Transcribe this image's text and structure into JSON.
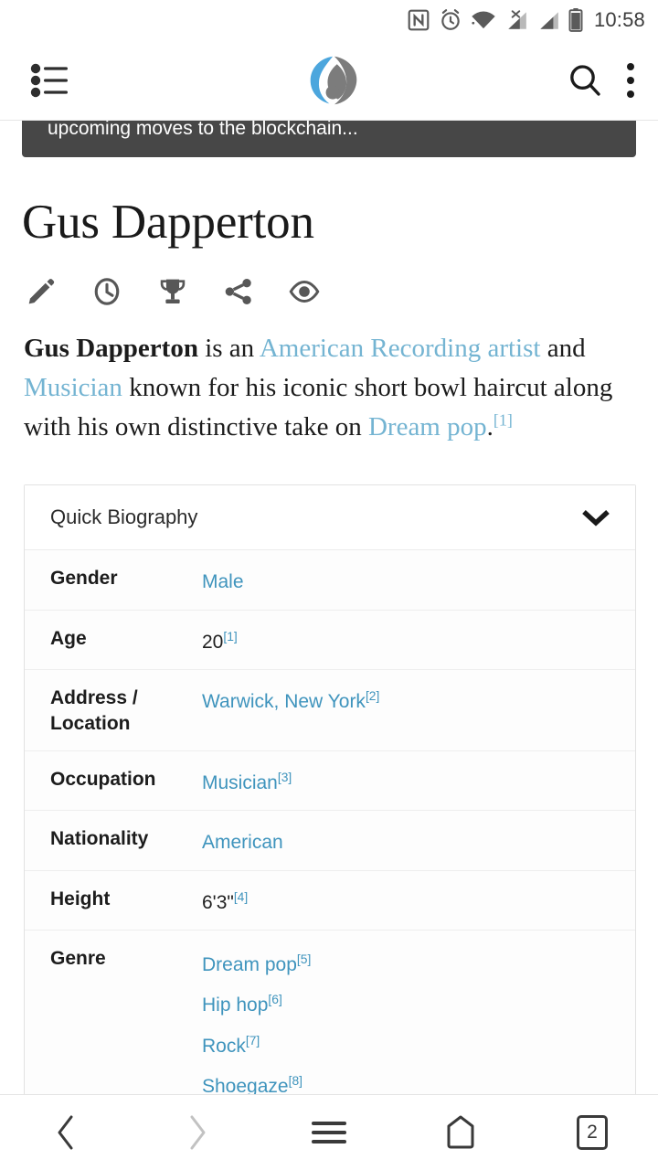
{
  "status_bar": {
    "time": "10:58",
    "icons": [
      "nfc-icon",
      "alarm-icon",
      "wifi-icon",
      "signal-no-sim-icon",
      "signal-icon",
      "battery-icon"
    ]
  },
  "app_bar": {
    "menu_icon": "list-menu-icon",
    "logo_icon": "everipedia-logo-icon",
    "logo_colors": {
      "blue": "#4ca6dd",
      "gray": "#7c7c7c"
    },
    "search_icon": "search-icon",
    "overflow_icon": "more-vertical-icon"
  },
  "banner": {
    "text": "upcoming moves to the blockchain...",
    "background": "#474747"
  },
  "article": {
    "title": "Gus Dapperton",
    "actions": [
      {
        "name": "edit-icon",
        "label": "Edit"
      },
      {
        "name": "history-clock-icon",
        "label": "History"
      },
      {
        "name": "trophy-icon",
        "label": "Awards"
      },
      {
        "name": "share-icon",
        "label": "Share"
      },
      {
        "name": "views-eye-icon",
        "label": "Views"
      }
    ],
    "lead": {
      "subject": "Gus Dapperton",
      "t1": " is an ",
      "link1": "American",
      "t2": " ",
      "link2": "Recording artist",
      "t3": " and ",
      "link3": "Musician",
      "t4": " known for his iconic short bowl haircut along with his own distinctive take on ",
      "link4": "Dream pop",
      "t5": ".",
      "ref": "[1]"
    }
  },
  "infobox": {
    "heading": "Quick Biography",
    "collapse_icon": "chevron-down-icon",
    "rows": [
      {
        "key": "Gender",
        "value": "Male",
        "link": true,
        "ref": ""
      },
      {
        "key": "Age",
        "value": "20",
        "link": false,
        "ref": "[1]"
      },
      {
        "key": "Address / Location",
        "value": "Warwick, New York",
        "link": true,
        "ref": "[2]"
      },
      {
        "key": "Occupation",
        "value": "Musician",
        "link": true,
        "ref": "[3]"
      },
      {
        "key": "Nationality",
        "value": "American",
        "link": true,
        "ref": ""
      },
      {
        "key": "Height",
        "value": "6'3\"",
        "link": false,
        "ref": "[4]"
      }
    ],
    "genre_row": {
      "key": "Genre",
      "values": [
        {
          "value": "Dream pop",
          "ref": "[5]"
        },
        {
          "value": "Hip hop",
          "ref": "[6]"
        },
        {
          "value": "Rock",
          "ref": "[7]"
        },
        {
          "value": "Shoegaze",
          "ref": "[8]"
        }
      ]
    }
  },
  "bottom_nav": {
    "back_icon": "chevron-left-icon",
    "forward_icon": "chevron-right-icon",
    "menu_icon": "hamburger-icon",
    "home_icon": "home-pentagon-icon",
    "tabs_count": "2"
  },
  "colors": {
    "link_serif": "#74b4d2",
    "link_table": "#3f94bd",
    "text": "#1c1c1c",
    "banner_bg": "#474747"
  }
}
